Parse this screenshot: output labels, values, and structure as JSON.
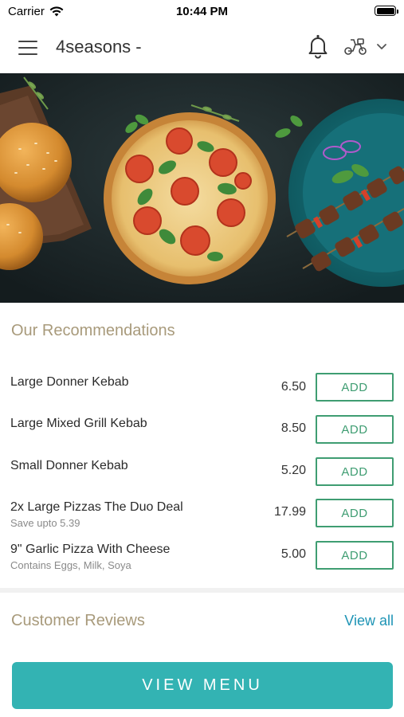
{
  "status_bar": {
    "carrier": "Carrier",
    "time": "10:44 PM"
  },
  "header": {
    "title": "4seasons -",
    "icons": [
      "menu-icon",
      "bell-icon",
      "scooter-icon",
      "chevron-down-icon"
    ]
  },
  "hero": {
    "image": "food-banner-burger-pizza-kebab"
  },
  "recommendations": {
    "title": "Our Recommendations",
    "add_label": "ADD",
    "items": [
      {
        "name": "Large Donner Kebab",
        "price": "6.50",
        "sub": ""
      },
      {
        "name": "Large Mixed Grill Kebab",
        "price": "8.50",
        "sub": ""
      },
      {
        "name": "Small Donner Kebab",
        "price": "5.20",
        "sub": ""
      },
      {
        "name": "2x Large Pizzas The Duo Deal",
        "price": "17.99",
        "sub": "Save upto 5.39"
      },
      {
        "name": "9\" Garlic Pizza With Cheese",
        "price": "5.00",
        "sub": "Contains Eggs, Milk, Soya"
      }
    ]
  },
  "reviews": {
    "title": "Customer Reviews",
    "view_all": "View all"
  },
  "footer": {
    "view_menu": "VIEW MENU"
  },
  "colors": {
    "accent_green": "#3f9d72",
    "teal_button": "#33b3b3",
    "link_blue": "#1e94b5",
    "section_title": "#a89a7b"
  }
}
